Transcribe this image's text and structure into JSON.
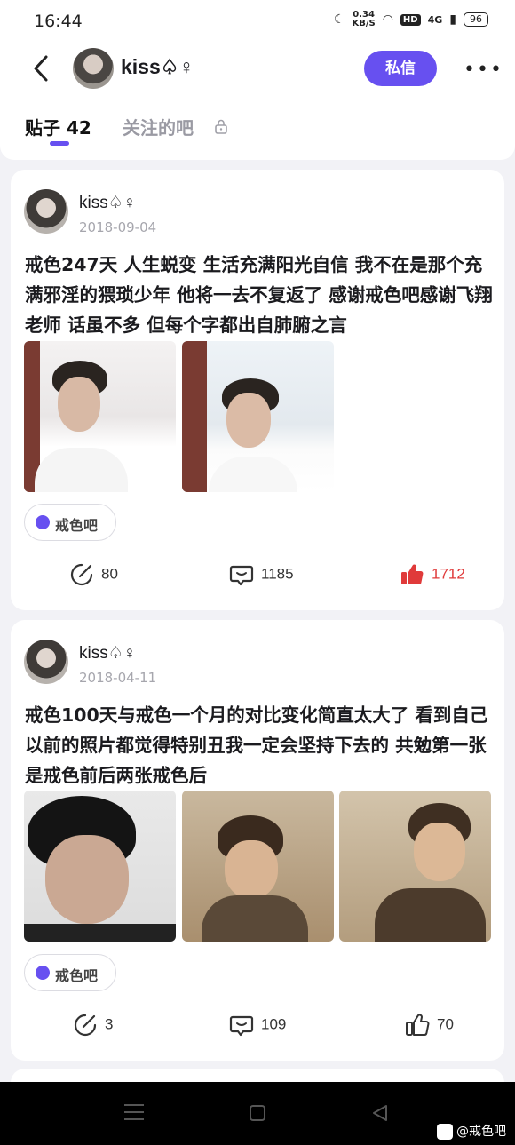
{
  "status_bar": {
    "time": "16:44",
    "net_speed": "0.34\nKB/S",
    "hd": "HD",
    "network": "4G",
    "battery": "96"
  },
  "header": {
    "username": "kiss♤♀",
    "dm_label": "私信",
    "more_label": "•••",
    "icons": [
      "back-icon",
      "more-icon"
    ]
  },
  "tabs": {
    "posts_label": "贴子 42",
    "followed_bars_label": "关注的吧"
  },
  "posts": [
    {
      "username": "kiss♤♀",
      "date": "2018-09-04",
      "text": "戒色247天 人生蜕变 生活充满阳光自信 我不在是那个充满邪淫的猥琐少年 他将一去不复返了 感谢戒色吧感谢飞翔老师 话虽不多 但每个字都出自肺腑之言",
      "tag": "戒色吧",
      "forwards": "80",
      "comments": "1185",
      "likes": "1712",
      "liked": true
    },
    {
      "username": "kiss♤♀",
      "date": "2018-04-11",
      "text": "戒色100天与戒色一个月的对比变化简直太大了 看到自己以前的照片都觉得特别丑我一定会坚持下去的 共勉第一张是戒色前后两张戒色后",
      "tag": "戒色吧",
      "forwards": "3",
      "comments": "109",
      "likes": "70",
      "liked": false
    }
  ],
  "watermark": "@戒色吧",
  "colors": {
    "accent": "#6750f0",
    "liked": "#e03a3a",
    "background": "#f2f2f6"
  }
}
